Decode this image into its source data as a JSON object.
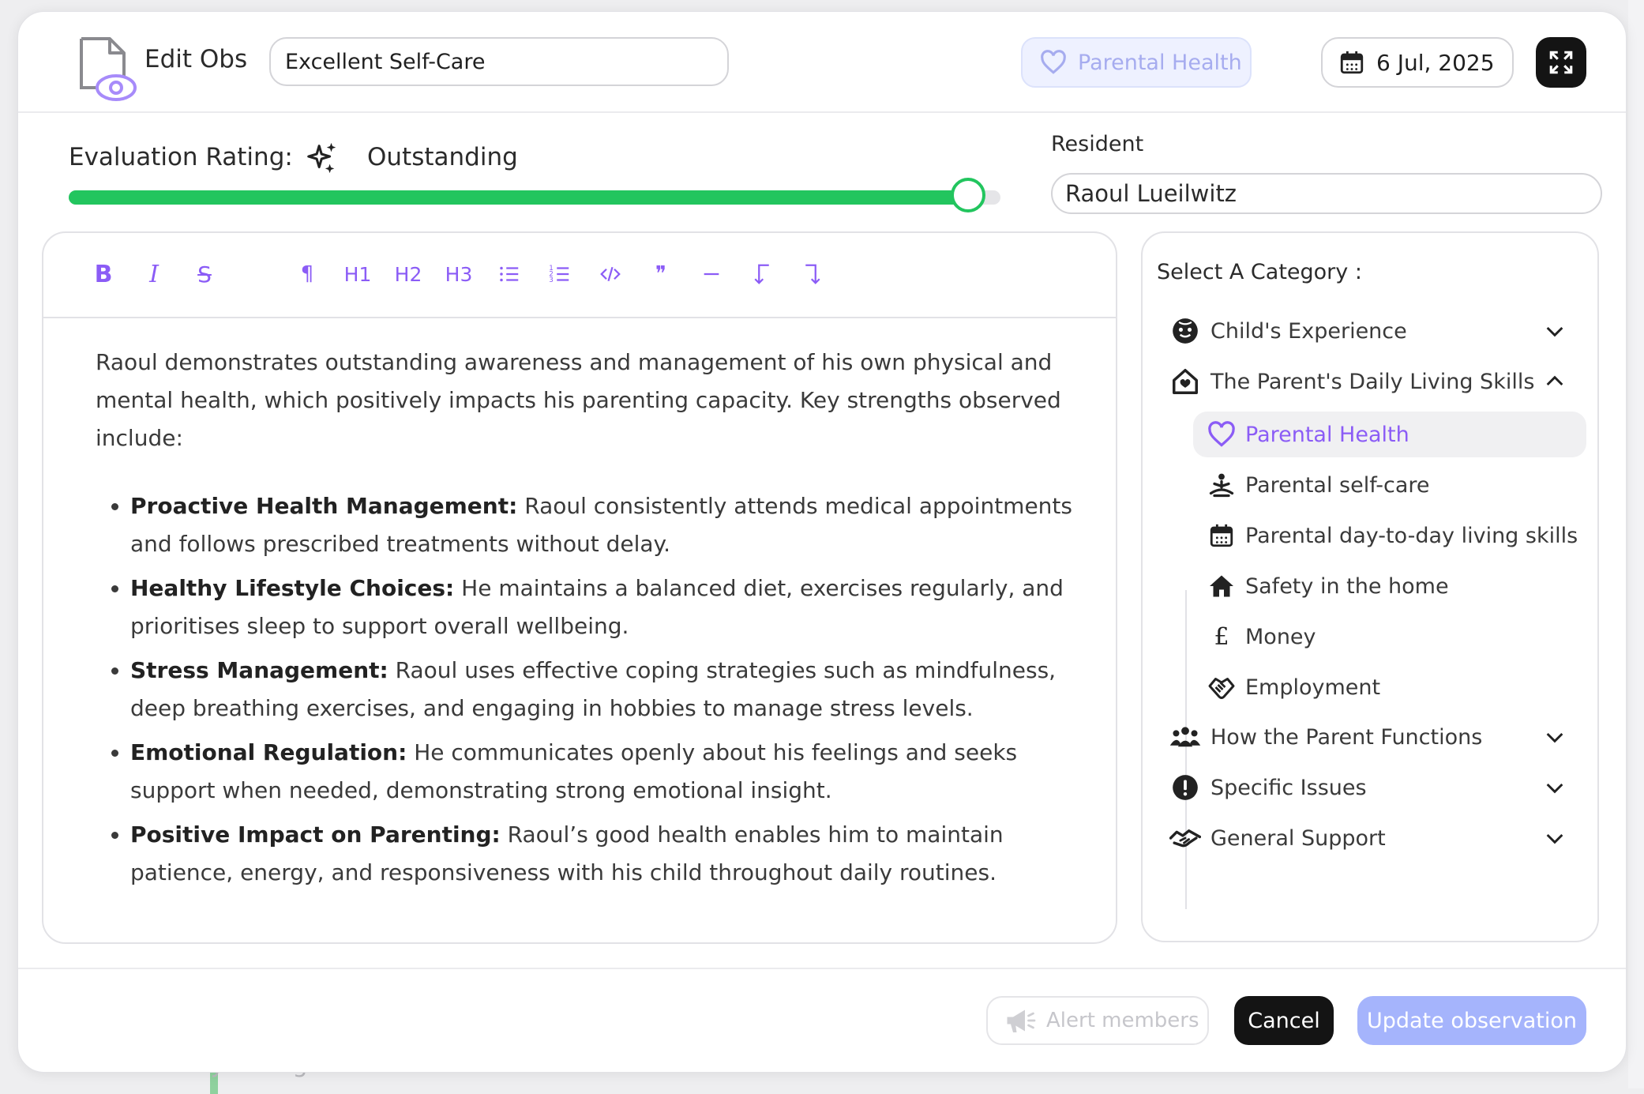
{
  "header": {
    "title": "Edit Obs",
    "title_input_value": "Excellent Self-Care",
    "category_badge": "Parental Health",
    "date": "6 Jul, 2025"
  },
  "rating": {
    "label": "Evaluation Rating:",
    "value": "Outstanding",
    "slider_fraction": 1.0,
    "fill_color": "#22c55e"
  },
  "resident": {
    "label": "Resident",
    "value": "Raoul Lueilwitz"
  },
  "toolbar": {
    "bold": "B",
    "italic": "I",
    "strike": "S",
    "paragraph": "¶",
    "h1": "H1",
    "h2": "H2",
    "h3": "H3",
    "quote": "❞",
    "accent_color": "#8b5cf6"
  },
  "editor": {
    "intro": "Raoul demonstrates outstanding awareness and management of his own physical and mental health, which positively impacts his parenting capacity. Key strengths observed include:",
    "bullets": [
      {
        "title": "Proactive Health Management:",
        "text": " Raoul consistently attends medical appointments and follows prescribed treatments without delay."
      },
      {
        "title": "Healthy Lifestyle Choices:",
        "text": " He maintains a balanced diet, exercises regularly, and prioritises sleep to support overall wellbeing."
      },
      {
        "title": "Stress Management:",
        "text": " Raoul uses effective coping strategies such as mindfulness, deep breathing exercises, and engaging in hobbies to manage stress levels."
      },
      {
        "title": "Emotional Regulation:",
        "text": " He communicates openly about his feelings and seeks support when needed, demonstrating strong emotional insight."
      },
      {
        "title": "Positive Impact on Parenting:",
        "text": " Raoul’s good health enables him to maintain patience, energy, and responsiveness with his child throughout daily routines."
      }
    ]
  },
  "categories": {
    "title": "Select A Category :",
    "groups": [
      {
        "label": "Child's Experience",
        "icon": "child-face-icon"
      },
      {
        "label": "The Parent's Daily Living Skills",
        "icon": "house-heart-icon",
        "expanded": true
      },
      {
        "label": "How the Parent Functions",
        "icon": "people-icon"
      },
      {
        "label": "Specific Issues",
        "icon": "alert-circle-icon"
      },
      {
        "label": "General Support",
        "icon": "handshake-icon"
      }
    ],
    "subitems": [
      {
        "label": "Parental Health",
        "icon": "heart-icon",
        "active": true
      },
      {
        "label": "Parental self-care",
        "icon": "meditation-icon"
      },
      {
        "label": "Parental day-to-day living skills",
        "icon": "calendar-icon"
      },
      {
        "label": "Safety in the home",
        "icon": "home-icon"
      },
      {
        "label": "Money",
        "icon": "pound-icon",
        "glyph": "£"
      },
      {
        "label": "Employment",
        "icon": "handshake-icon"
      }
    ]
  },
  "footer": {
    "alert_label": "Alert members",
    "cancel_label": "Cancel",
    "update_label": "Update observation"
  },
  "background": {
    "snippet": "Key strengths observed include:"
  }
}
